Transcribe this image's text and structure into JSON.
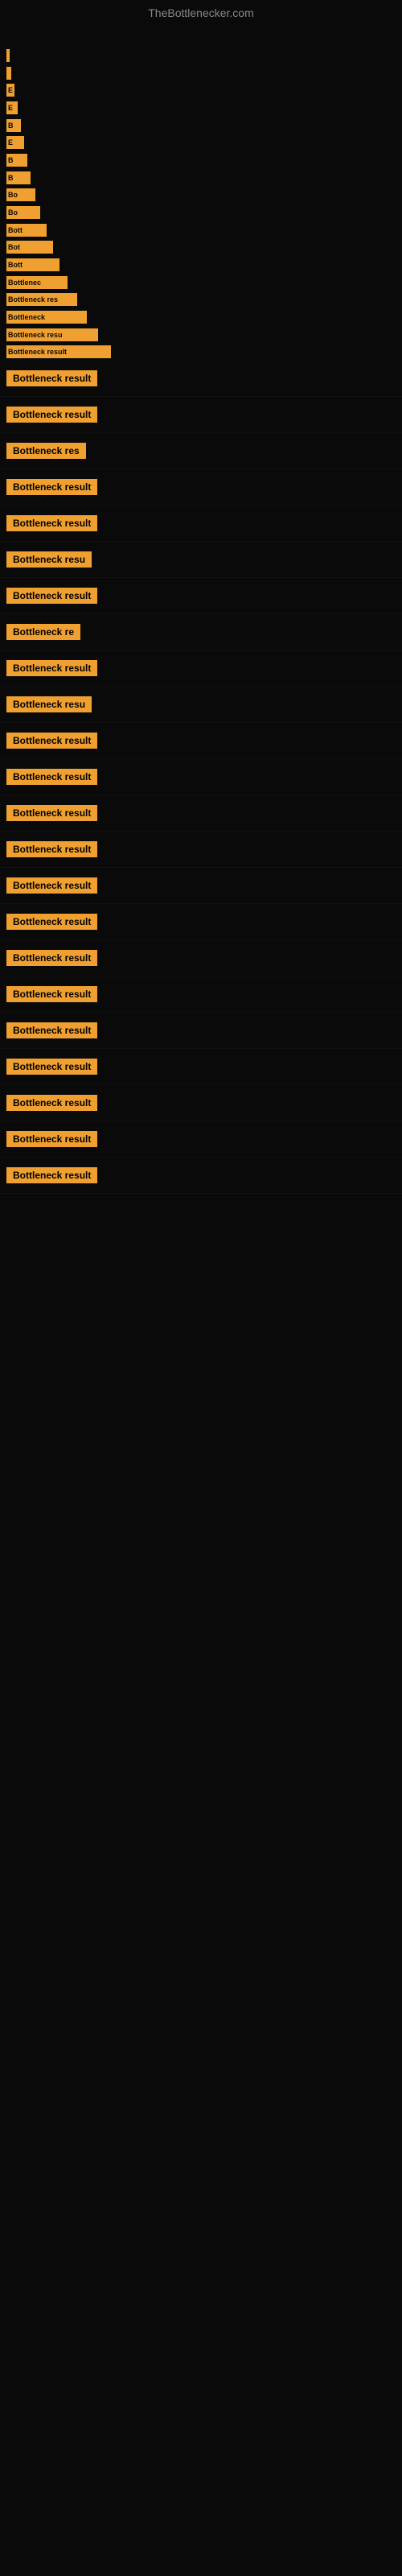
{
  "site": {
    "title": "TheBottlenecker.com"
  },
  "chart": {
    "bars": [
      {
        "id": 1,
        "label": "",
        "width_class": "bar-w-1"
      },
      {
        "id": 2,
        "label": "",
        "width_class": "bar-w-2"
      },
      {
        "id": 3,
        "label": "E",
        "width_class": "bar-w-3"
      },
      {
        "id": 4,
        "label": "E",
        "width_class": "bar-w-4"
      },
      {
        "id": 5,
        "label": "B",
        "width_class": "bar-w-5"
      },
      {
        "id": 6,
        "label": "E",
        "width_class": "bar-w-6"
      },
      {
        "id": 7,
        "label": "B",
        "width_class": "bar-w-7"
      },
      {
        "id": 8,
        "label": "B",
        "width_class": "bar-w-8"
      },
      {
        "id": 9,
        "label": "Bo",
        "width_class": "bar-w-9"
      },
      {
        "id": 10,
        "label": "Bo",
        "width_class": "bar-w-10"
      },
      {
        "id": 11,
        "label": "Bott",
        "width_class": "bar-w-11"
      },
      {
        "id": 12,
        "label": "Bot",
        "width_class": "bar-w-12"
      },
      {
        "id": 13,
        "label": "Bott",
        "width_class": "bar-w-13"
      },
      {
        "id": 14,
        "label": "Bottlenec",
        "width_class": "bar-w-14"
      },
      {
        "id": 15,
        "label": "Bottleneck res",
        "width_class": "bar-w-15"
      },
      {
        "id": 16,
        "label": "Bottleneck",
        "width_class": "bar-w-16"
      },
      {
        "id": 17,
        "label": "Bottleneck resu",
        "width_class": "bar-w-17"
      },
      {
        "id": 18,
        "label": "Bottleneck result",
        "width_class": "bar-w-18"
      }
    ]
  },
  "results": [
    {
      "id": 1,
      "label": "Bottleneck result"
    },
    {
      "id": 2,
      "label": "Bottleneck result"
    },
    {
      "id": 3,
      "label": "Bottleneck res"
    },
    {
      "id": 4,
      "label": "Bottleneck result"
    },
    {
      "id": 5,
      "label": "Bottleneck result"
    },
    {
      "id": 6,
      "label": "Bottleneck resu"
    },
    {
      "id": 7,
      "label": "Bottleneck result"
    },
    {
      "id": 8,
      "label": "Bottleneck re"
    },
    {
      "id": 9,
      "label": "Bottleneck result"
    },
    {
      "id": 10,
      "label": "Bottleneck resu"
    },
    {
      "id": 11,
      "label": "Bottleneck result"
    },
    {
      "id": 12,
      "label": "Bottleneck result"
    },
    {
      "id": 13,
      "label": "Bottleneck result"
    },
    {
      "id": 14,
      "label": "Bottleneck result"
    },
    {
      "id": 15,
      "label": "Bottleneck result"
    },
    {
      "id": 16,
      "label": "Bottleneck result"
    },
    {
      "id": 17,
      "label": "Bottleneck result"
    },
    {
      "id": 18,
      "label": "Bottleneck result"
    },
    {
      "id": 19,
      "label": "Bottleneck result"
    },
    {
      "id": 20,
      "label": "Bottleneck result"
    },
    {
      "id": 21,
      "label": "Bottleneck result"
    },
    {
      "id": 22,
      "label": "Bottleneck result"
    },
    {
      "id": 23,
      "label": "Bottleneck result"
    }
  ]
}
